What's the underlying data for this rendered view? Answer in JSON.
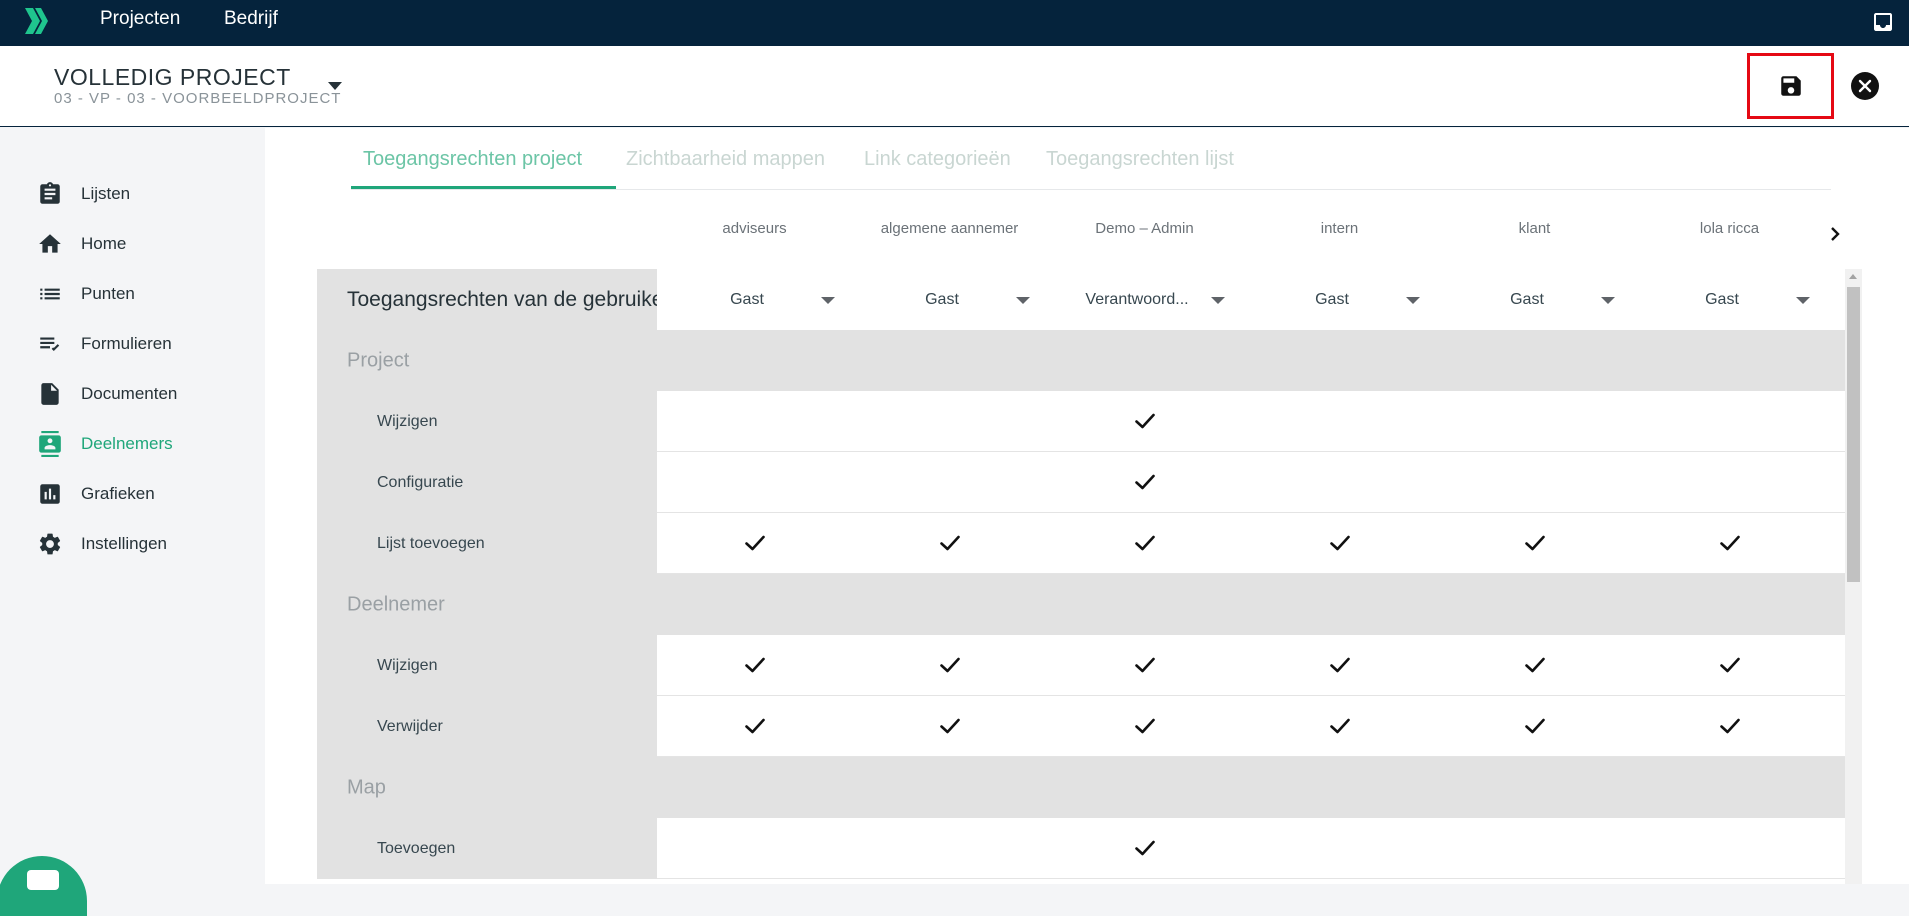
{
  "topbar": {
    "nav": [
      "Projecten",
      "Bedrijf"
    ]
  },
  "project": {
    "title": "VOLLEDIG PROJECT",
    "subtitle": "03 - VP - 03 - VOORBEELDPROJECT"
  },
  "sidebar": {
    "items": [
      {
        "label": "Lijsten",
        "icon": "clipboard-icon"
      },
      {
        "label": "Home",
        "icon": "home-icon"
      },
      {
        "label": "Punten",
        "icon": "list-icon"
      },
      {
        "label": "Formulieren",
        "icon": "checklist-icon"
      },
      {
        "label": "Documenten",
        "icon": "document-icon"
      },
      {
        "label": "Deelnemers",
        "icon": "contact-icon",
        "active": true
      },
      {
        "label": "Grafieken",
        "icon": "chart-icon"
      },
      {
        "label": "Instellingen",
        "icon": "gear-icon"
      }
    ]
  },
  "tabs": [
    "Toegangsrechten project",
    "Zichtbaarheid mappen",
    "Link categorieën",
    "Toegangsrechten lijst"
  ],
  "columns": [
    "adviseurs",
    "algemene aannemer",
    "Demo – Admin",
    "intern",
    "klant",
    "lola ricca"
  ],
  "table": {
    "header_label": "Toegangsrechten van de gebruiker",
    "roles": [
      "Gast",
      "Gast",
      "Verantwoord...",
      "Gast",
      "Gast",
      "Gast"
    ],
    "rows": [
      {
        "type": "section",
        "label": "Project"
      },
      {
        "type": "item",
        "label": "Wijzigen",
        "checks": [
          false,
          false,
          true,
          false,
          false,
          false
        ]
      },
      {
        "type": "item",
        "label": "Configuratie",
        "checks": [
          false,
          false,
          true,
          false,
          false,
          false
        ]
      },
      {
        "type": "item",
        "label": "Lijst toevoegen",
        "checks": [
          true,
          true,
          true,
          true,
          true,
          true
        ]
      },
      {
        "type": "section",
        "label": "Deelnemer"
      },
      {
        "type": "item",
        "label": "Wijzigen",
        "checks": [
          true,
          true,
          true,
          true,
          true,
          true
        ]
      },
      {
        "type": "item",
        "label": "Verwijder",
        "checks": [
          true,
          true,
          true,
          true,
          true,
          true
        ]
      },
      {
        "type": "section",
        "label": "Map"
      },
      {
        "type": "item",
        "label": "Toevoegen",
        "checks": [
          false,
          false,
          true,
          false,
          false,
          false
        ]
      }
    ]
  },
  "colors": {
    "topbar": "#05233c",
    "accent": "#1fa67a",
    "save_highlight": "#e50914"
  }
}
